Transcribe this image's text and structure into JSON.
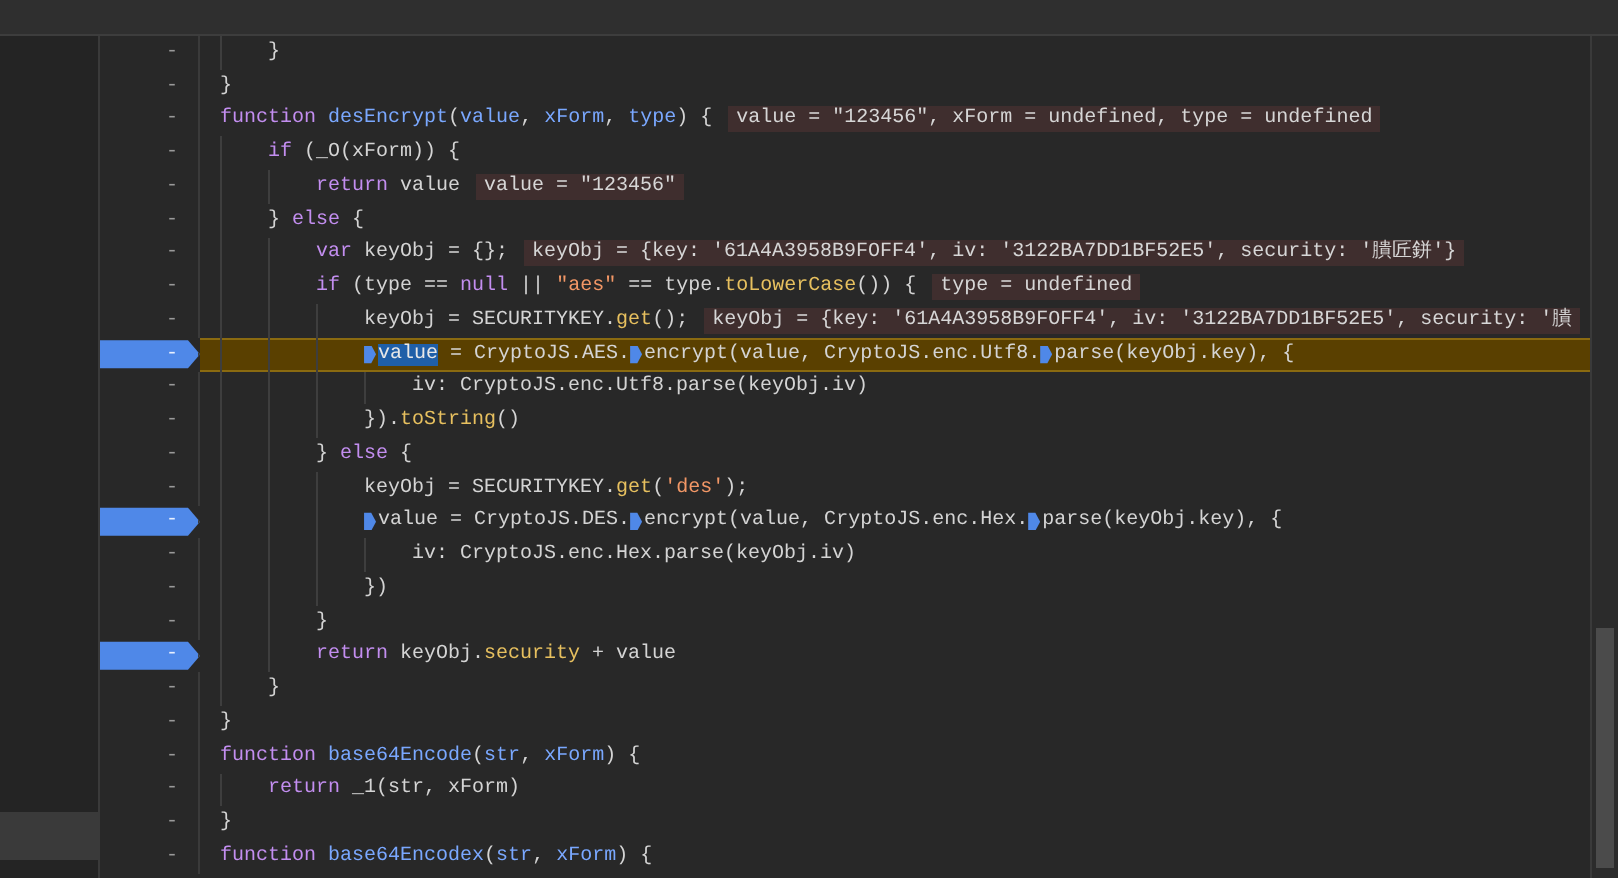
{
  "lines": [
    {
      "gutter": "-",
      "breakpoint": false,
      "highlighted": false,
      "tokens": [
        {
          "kind": "plain",
          "text": "    }"
        }
      ]
    },
    {
      "gutter": "-",
      "breakpoint": false,
      "highlighted": false,
      "tokens": [
        {
          "kind": "plain",
          "text": "}"
        }
      ]
    },
    {
      "gutter": "-",
      "breakpoint": false,
      "highlighted": false,
      "tokens": [
        {
          "kind": "keyword",
          "text": "function "
        },
        {
          "kind": "fn",
          "text": "desEncrypt"
        },
        {
          "kind": "plain",
          "text": "("
        },
        {
          "kind": "fn",
          "text": "value"
        },
        {
          "kind": "plain",
          "text": ", "
        },
        {
          "kind": "fn",
          "text": "xForm"
        },
        {
          "kind": "plain",
          "text": ", "
        },
        {
          "kind": "fn",
          "text": "type"
        },
        {
          "kind": "plain",
          "text": ") {"
        }
      ],
      "annotation": "value = \"123456\", xForm = undefined, type = undefined"
    },
    {
      "gutter": "-",
      "breakpoint": false,
      "highlighted": false,
      "tokens": [
        {
          "kind": "keyword",
          "text": "    if"
        },
        {
          "kind": "plain",
          "text": " (_O(xForm)) {"
        }
      ]
    },
    {
      "gutter": "-",
      "breakpoint": false,
      "highlighted": false,
      "tokens": [
        {
          "kind": "keyword",
          "text": "        return"
        },
        {
          "kind": "plain",
          "text": " value"
        }
      ],
      "annotation": "value = \"123456\""
    },
    {
      "gutter": "-",
      "breakpoint": false,
      "highlighted": false,
      "tokens": [
        {
          "kind": "plain",
          "text": "    } "
        },
        {
          "kind": "keyword",
          "text": "else"
        },
        {
          "kind": "plain",
          "text": " {"
        }
      ]
    },
    {
      "gutter": "-",
      "breakpoint": false,
      "highlighted": false,
      "tokens": [
        {
          "kind": "keyword",
          "text": "        var"
        },
        {
          "kind": "plain",
          "text": " keyObj = {};"
        }
      ],
      "annotation": "keyObj = {key: '61A4A3958B9FOFF4', iv: '3122BA7DD1BF52E5', security: '膭匠鉼'}"
    },
    {
      "gutter": "-",
      "breakpoint": false,
      "highlighted": false,
      "tokens": [
        {
          "kind": "keyword",
          "text": "        if"
        },
        {
          "kind": "plain",
          "text": " (type == "
        },
        {
          "kind": "keyword",
          "text": "null"
        },
        {
          "kind": "plain",
          "text": " || "
        },
        {
          "kind": "string",
          "text": "\"aes\""
        },
        {
          "kind": "plain",
          "text": " == type."
        },
        {
          "kind": "method",
          "text": "toLowerCase"
        },
        {
          "kind": "plain",
          "text": "()) {"
        }
      ],
      "annotation": "type = undefined"
    },
    {
      "gutter": "-",
      "breakpoint": false,
      "highlighted": false,
      "tokens": [
        {
          "kind": "plain",
          "text": "            keyObj = SECURITYKEY."
        },
        {
          "kind": "method",
          "text": "get"
        },
        {
          "kind": "plain",
          "text": "();"
        }
      ],
      "annotation": "keyObj = {key: '61A4A3958B9FOFF4', iv: '3122BA7DD1BF52E5', security: '膭"
    },
    {
      "gutter": "-",
      "breakpoint": true,
      "highlighted": true,
      "tokens": [
        {
          "kind": "selected",
          "marker": true,
          "text": "            value"
        },
        {
          "kind": "plain",
          "text": " = CryptoJS.AES."
        },
        {
          "kind": "plain",
          "marker": true,
          "text": "encrypt(value, CryptoJS.enc.Utf8."
        },
        {
          "kind": "plain",
          "marker": true,
          "text": "parse(keyObj.key), {"
        }
      ]
    },
    {
      "gutter": "-",
      "breakpoint": false,
      "highlighted": false,
      "tokens": [
        {
          "kind": "plain",
          "text": "                iv: CryptoJS.enc.Utf8.parse(keyObj.iv)"
        }
      ]
    },
    {
      "gutter": "-",
      "breakpoint": false,
      "highlighted": false,
      "tokens": [
        {
          "kind": "plain",
          "text": "            })."
        },
        {
          "kind": "method",
          "text": "toString"
        },
        {
          "kind": "plain",
          "text": "()"
        }
      ]
    },
    {
      "gutter": "-",
      "breakpoint": false,
      "highlighted": false,
      "tokens": [
        {
          "kind": "plain",
          "text": "        } "
        },
        {
          "kind": "keyword",
          "text": "else"
        },
        {
          "kind": "plain",
          "text": " {"
        }
      ]
    },
    {
      "gutter": "-",
      "breakpoint": false,
      "highlighted": false,
      "tokens": [
        {
          "kind": "plain",
          "text": "            keyObj = SECURITYKEY."
        },
        {
          "kind": "method",
          "text": "get"
        },
        {
          "kind": "plain",
          "text": "("
        },
        {
          "kind": "string",
          "text": "'des'"
        },
        {
          "kind": "plain",
          "text": ");"
        }
      ]
    },
    {
      "gutter": "-",
      "breakpoint": true,
      "highlighted": false,
      "tokens": [
        {
          "kind": "plain",
          "marker": true,
          "text": "            value = CryptoJS.DES."
        },
        {
          "kind": "plain",
          "marker": true,
          "text": "encrypt(value, CryptoJS.enc.Hex."
        },
        {
          "kind": "plain",
          "marker": true,
          "text": "parse(keyObj.key), {"
        }
      ]
    },
    {
      "gutter": "-",
      "breakpoint": false,
      "highlighted": false,
      "tokens": [
        {
          "kind": "plain",
          "text": "                iv: CryptoJS.enc.Hex.parse(keyObj.iv)"
        }
      ]
    },
    {
      "gutter": "-",
      "breakpoint": false,
      "highlighted": false,
      "tokens": [
        {
          "kind": "plain",
          "text": "            })"
        }
      ]
    },
    {
      "gutter": "-",
      "breakpoint": false,
      "highlighted": false,
      "tokens": [
        {
          "kind": "plain",
          "text": "        }"
        }
      ]
    },
    {
      "gutter": "-",
      "breakpoint": true,
      "highlighted": false,
      "tokens": [
        {
          "kind": "keyword",
          "text": "        return"
        },
        {
          "kind": "plain",
          "text": " keyObj."
        },
        {
          "kind": "method",
          "text": "security"
        },
        {
          "kind": "plain",
          "text": " + value"
        }
      ]
    },
    {
      "gutter": "-",
      "breakpoint": false,
      "highlighted": false,
      "tokens": [
        {
          "kind": "plain",
          "text": "    }"
        }
      ]
    },
    {
      "gutter": "-",
      "breakpoint": false,
      "highlighted": false,
      "tokens": [
        {
          "kind": "plain",
          "text": "}"
        }
      ]
    },
    {
      "gutter": "-",
      "breakpoint": false,
      "highlighted": false,
      "tokens": [
        {
          "kind": "keyword",
          "text": "function "
        },
        {
          "kind": "fn",
          "text": "base64Encode"
        },
        {
          "kind": "plain",
          "text": "("
        },
        {
          "kind": "fn",
          "text": "str"
        },
        {
          "kind": "plain",
          "text": ", "
        },
        {
          "kind": "fn",
          "text": "xForm"
        },
        {
          "kind": "plain",
          "text": ") {"
        }
      ]
    },
    {
      "gutter": "-",
      "breakpoint": false,
      "highlighted": false,
      "tokens": [
        {
          "kind": "keyword",
          "text": "    return"
        },
        {
          "kind": "plain",
          "text": " _1(str, xForm)"
        }
      ]
    },
    {
      "gutter": "-",
      "breakpoint": false,
      "highlighted": false,
      "tokens": [
        {
          "kind": "plain",
          "text": "}"
        }
      ]
    },
    {
      "gutter": "-",
      "breakpoint": false,
      "highlighted": false,
      "tokens": [
        {
          "kind": "keyword",
          "text": "function "
        },
        {
          "kind": "fn",
          "text": "base64Encodex"
        },
        {
          "kind": "plain",
          "text": "("
        },
        {
          "kind": "fn",
          "text": "str"
        },
        {
          "kind": "plain",
          "text": ", "
        },
        {
          "kind": "fn",
          "text": "xForm"
        },
        {
          "kind": "plain",
          "text": ") {"
        }
      ]
    }
  ]
}
